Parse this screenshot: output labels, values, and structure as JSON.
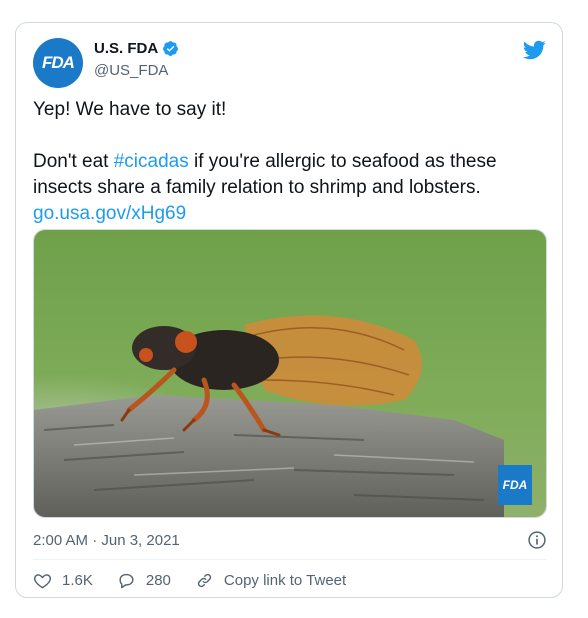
{
  "author": {
    "display_name": "U.S. FDA",
    "handle": "@US_FDA",
    "avatar_text": "FDA",
    "verified": true
  },
  "tweet": {
    "line1": "Yep! We have to say it!",
    "line2_pre": "Don't eat ",
    "hashtag": "#cicadas",
    "line2_post": " if you're allergic to seafood as these insects share a family relation to shrimp and lobsters.",
    "url": "go.usa.gov/xHg69"
  },
  "media": {
    "badge_text": "FDA"
  },
  "meta": {
    "timestamp": "2:00 AM · Jun 3, 2021"
  },
  "actions": {
    "likes": "1.6K",
    "replies": "280",
    "copy_link": "Copy link to Tweet"
  },
  "colors": {
    "accent": "#1d9bf0",
    "fda_blue": "#1a7ac7",
    "muted": "#536471"
  }
}
